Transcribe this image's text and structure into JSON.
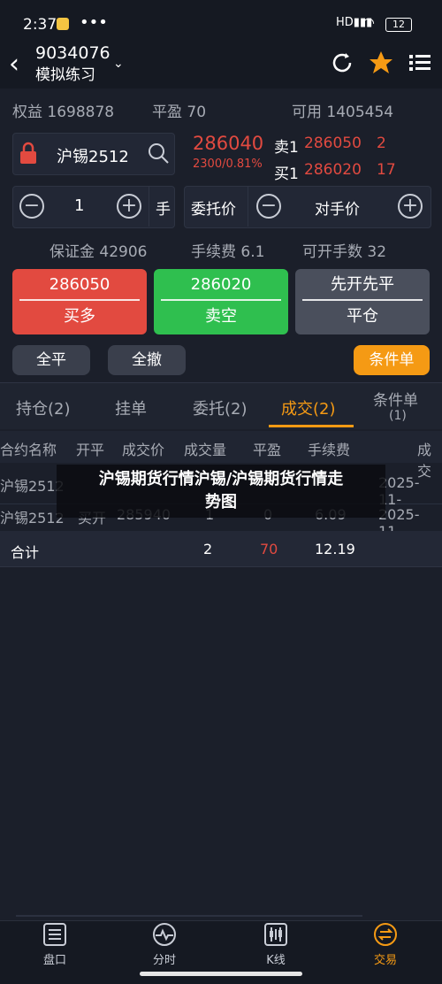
{
  "status": {
    "time": "2:37",
    "battery": "12"
  },
  "header": {
    "account": "9034076",
    "mode": "模拟练习"
  },
  "info": {
    "equity": "权益 1698878",
    "pnl": "平盈 70",
    "available": "可用 1405454"
  },
  "contract": {
    "name": "沪锡2512",
    "price": "286040",
    "change": "2300/0.81%"
  },
  "quotes": {
    "sell_label": "卖1",
    "sell_price": "286050",
    "sell_qty": "2",
    "buy_label": "买1",
    "buy_price": "286020",
    "buy_qty": "17"
  },
  "order": {
    "qty": "1",
    "unit": "手",
    "price_type": "委托价",
    "counterparty": "对手价"
  },
  "stats": {
    "margin": "保证金 42906",
    "fee": "手续费 6.1",
    "openable": "可开手数 32"
  },
  "actions": {
    "buy_price": "286050",
    "buy_label": "买多",
    "sell_price": "286020",
    "sell_label": "卖空",
    "close_top": "先开先平",
    "close_label": "平仓",
    "close_all": "全平",
    "cancel_all": "全撤",
    "conditional": "条件单"
  },
  "tabs": [
    "持仓(2)",
    "挂单",
    "委托(2)",
    "成交(2)",
    "条件单",
    "(1)"
  ],
  "table": {
    "headers": [
      "合约名称",
      "开平",
      "成交价",
      "成交量",
      "平盈",
      "手续费",
      "成交"
    ],
    "rows": [
      [
        "沪锡2512",
        "",
        "",
        "",
        "",
        "",
        "2025-11-"
      ],
      [
        "沪锡2512",
        "买开",
        "285940",
        "1",
        "0",
        "6.09",
        "2025-11-"
      ]
    ],
    "total": {
      "label": "合计",
      "qty": "2",
      "pnl": "70",
      "fee": "12.19"
    }
  },
  "overlay": {
    "line1": "沪锡期货行情沪锡/沪锡期货行情走",
    "line2": "势图"
  },
  "nav": [
    "盘口",
    "分时",
    "K线",
    "交易"
  ],
  "colors": {
    "red": "#e24a40",
    "green": "#2fbf4f",
    "orange": "#f59a14",
    "bg": "#1b1f2a"
  }
}
